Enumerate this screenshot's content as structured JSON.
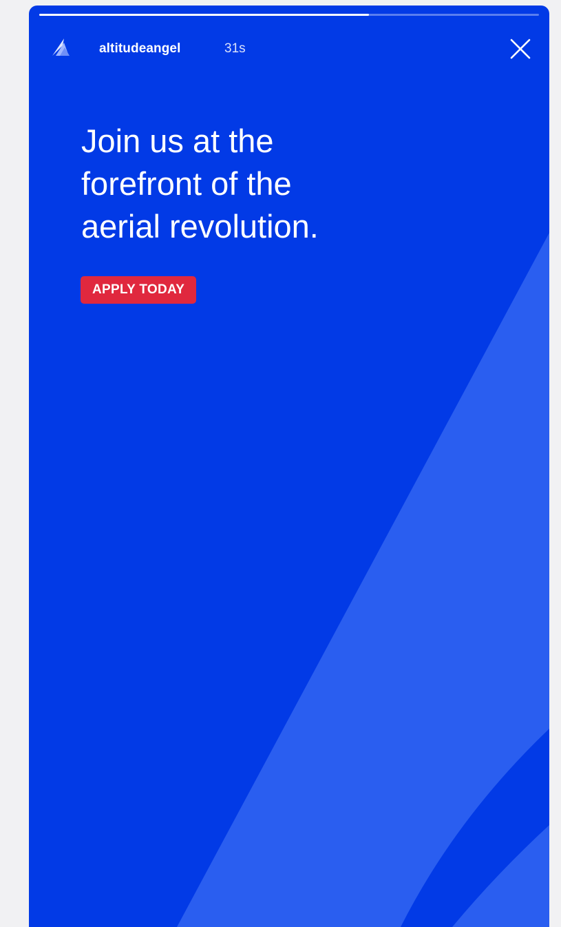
{
  "story": {
    "progress_fraction": 0.66,
    "account": {
      "username": "altitudeangel",
      "time_ago": "31s",
      "logo_icon": "altitude-angel-logo-icon"
    },
    "close_icon": "close-icon",
    "headline": "Join us at the\nforefront of the\naerial revolution.",
    "cta_label": "APPLY TODAY"
  },
  "colors": {
    "background": "#023ae6",
    "accent_shape": "#2a5ef0",
    "cta": "#e0283e",
    "text": "#ffffff"
  }
}
